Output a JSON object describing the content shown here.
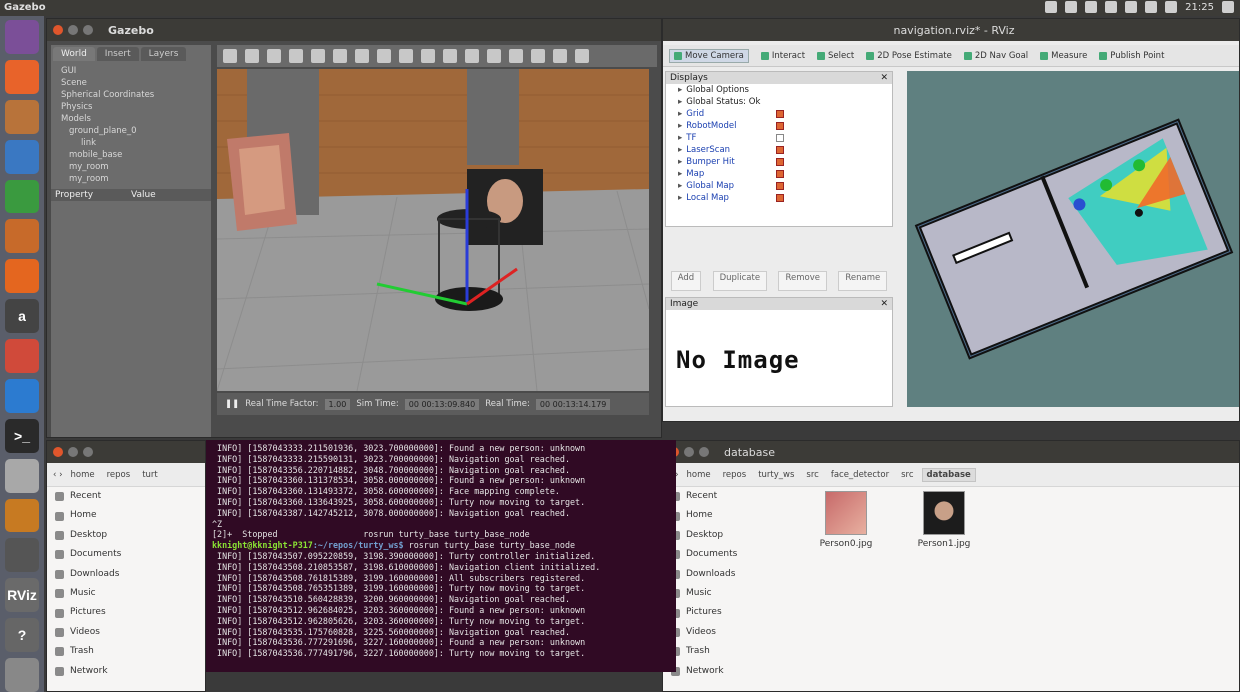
{
  "topbar": {
    "title": "Gazebo",
    "time": "21:25"
  },
  "launcher": {
    "items": [
      {
        "icon": "ubuntu-dash-icon",
        "color": "#7b4f98"
      },
      {
        "icon": "firefox-icon",
        "color": "#e8632a"
      },
      {
        "icon": "files-icon",
        "color": "#b8733a"
      },
      {
        "icon": "writer-icon",
        "color": "#3a78c2"
      },
      {
        "icon": "calc-icon",
        "color": "#3a9a3f"
      },
      {
        "icon": "impress-icon",
        "color": "#c76a2a"
      },
      {
        "icon": "software-center-icon",
        "color": "#e4661f"
      },
      {
        "icon": "amazon-icon",
        "color": "#444444",
        "label": "a"
      },
      {
        "icon": "settings-icon",
        "color": "#d04a3a"
      },
      {
        "icon": "vscode-icon",
        "color": "#2c7bd0"
      },
      {
        "icon": "terminal-icon",
        "color": "#2a2a2a",
        "label": ">_"
      },
      {
        "icon": "text-editor-icon",
        "color": "#a8a8a8"
      },
      {
        "icon": "gazebo-icon",
        "color": "#c77a22"
      },
      {
        "icon": "video-icon",
        "color": "#555555"
      },
      {
        "icon": "rviz-icon",
        "color": "#6a6a6a",
        "label": "RViz"
      },
      {
        "icon": "help-icon",
        "color": "#666666",
        "label": "?"
      },
      {
        "icon": "trash-icon",
        "color": "#888888"
      }
    ]
  },
  "gazebo": {
    "title": "Gazebo",
    "tabs": [
      "World",
      "Insert",
      "Layers"
    ],
    "tree": [
      "GUI",
      "Scene",
      "Spherical Coordinates",
      "Physics",
      "Models",
      "ground_plane_0",
      "link",
      "mobile_base",
      "my_room",
      "my_room"
    ],
    "prop_headers": [
      "Property",
      "Value"
    ],
    "status": {
      "rtf_label": "Real Time Factor:",
      "rtf_value": "1.00",
      "sim_label": "Sim Time:",
      "sim_value": "00 00:13:09.840",
      "real_label": "Real Time:",
      "real_value": "00 00:13:14.179"
    }
  },
  "rviz": {
    "title": "navigation.rviz* - RViz",
    "tools": [
      "Move Camera",
      "Interact",
      "Select",
      "2D Pose Estimate",
      "2D Nav Goal",
      "Measure",
      "Publish Point"
    ],
    "displays_title": "Displays",
    "displays": [
      {
        "label": "Global Options",
        "check": null
      },
      {
        "label": "Global Status: Ok",
        "check": null
      },
      {
        "label": "Grid",
        "check": true
      },
      {
        "label": "RobotModel",
        "check": true
      },
      {
        "label": "TF",
        "check": false
      },
      {
        "label": "LaserScan",
        "check": true
      },
      {
        "label": "Bumper Hit",
        "check": true
      },
      {
        "label": "Map",
        "check": true
      },
      {
        "label": "Global Map",
        "check": true
      },
      {
        "label": "Local Map",
        "check": true
      }
    ],
    "buttons": [
      "Add",
      "Duplicate",
      "Remove",
      "Rename"
    ],
    "image_panel_title": "Image",
    "no_image": "No Image"
  },
  "terminal": {
    "lines": [
      " INFO] [1587043333.211501936, 3023.700000000]: Found a new person: unknown",
      " INFO] [1587043333.215590131, 3023.700000000]: Navigation goal reached.",
      " INFO] [1587043356.220714882, 3048.700000000]: Navigation goal reached.",
      " INFO] [1587043360.131378534, 3058.000000000]: Found a new person: unknown",
      " INFO] [1587043360.131493372, 3058.600000000]: Face mapping complete.",
      " INFO] [1587043360.133643925, 3058.600000000]: Turty now moving to target.",
      " INFO] [1587043387.142745212, 3078.000000000]: Navigation goal reached.",
      "^Z",
      "[2]+  Stopped                 rosrun turty_base turty_base_node"
    ],
    "prompt_user": "kknight@kknight-P317",
    "prompt_path": ":~/repos/turty_ws$",
    "command": " rosrun turty_base turty_base_node",
    "lines2": [
      " INFO] [1587043507.095220859, 3198.390000000]: Turty controller initialized.",
      " INFO] [1587043508.210853587, 3198.610000000]: Navigation client initialized.",
      " INFO] [1587043508.761815389, 3199.160000000]: All subscribers registered.",
      " INFO] [1587043508.765351389, 3199.160000000]: Turty now moving to target.",
      " INFO] [1587043510.560428839, 3200.960000000]: Navigation goal reached.",
      " INFO] [1587043512.962684025, 3203.360000000]: Found a new person: unknown",
      " INFO] [1587043512.962805626, 3203.360000000]: Turty now moving to target.",
      " INFO] [1587043535.175760828, 3225.560000000]: Navigation goal reached.",
      " INFO] [1587043536.777291696, 3227.160000000]: Found a new person: unknown",
      " INFO] [1587043536.777491796, 3227.160000000]: Turty now moving to target."
    ]
  },
  "fm_left": {
    "path": [
      "home",
      "repos",
      "turt"
    ],
    "sidebar": [
      "Recent",
      "Home",
      "Desktop",
      "Documents",
      "Downloads",
      "Music",
      "Pictures",
      "Videos",
      "Trash",
      "Network"
    ]
  },
  "fm_right": {
    "title": "database",
    "path": [
      "home",
      "repos",
      "turty_ws",
      "src",
      "face_detector",
      "src",
      "database"
    ],
    "sidebar": [
      "Recent",
      "Home",
      "Desktop",
      "Documents",
      "Downloads",
      "Music",
      "Pictures",
      "Videos",
      "Trash",
      "Network"
    ],
    "files": [
      "Person0.jpg",
      "Person1.jpg"
    ]
  }
}
